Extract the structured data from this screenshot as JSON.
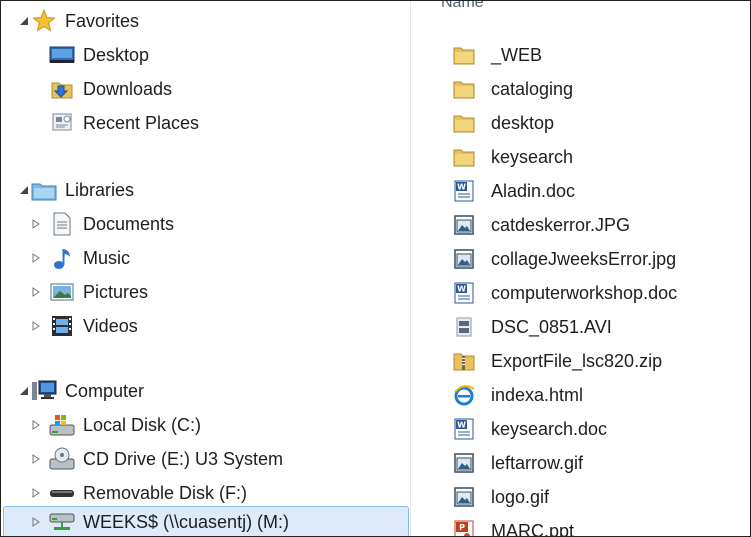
{
  "nav": {
    "favorites": {
      "label": "Favorites",
      "items": [
        {
          "label": "Desktop",
          "icon": "desktop-icon"
        },
        {
          "label": "Downloads",
          "icon": "downloads-icon"
        },
        {
          "label": "Recent Places",
          "icon": "recent-places-icon"
        }
      ]
    },
    "libraries": {
      "label": "Libraries",
      "items": [
        {
          "label": "Documents",
          "icon": "documents-icon"
        },
        {
          "label": "Music",
          "icon": "music-icon"
        },
        {
          "label": "Pictures",
          "icon": "pictures-icon"
        },
        {
          "label": "Videos",
          "icon": "videos-icon"
        }
      ]
    },
    "computer": {
      "label": "Computer",
      "items": [
        {
          "label": "Local Disk (C:)",
          "icon": "local-disk-icon"
        },
        {
          "label": "CD Drive (E:) U3 System",
          "icon": "cd-drive-icon"
        },
        {
          "label": "Removable Disk (F:)",
          "icon": "removable-disk-icon"
        },
        {
          "label": "WEEKS$ (\\\\cuasentj) (M:)",
          "icon": "network-drive-icon",
          "selected": true
        }
      ]
    }
  },
  "files": {
    "column_header": "Name",
    "items": [
      {
        "name": "_WEB",
        "type": "folder"
      },
      {
        "name": "cataloging",
        "type": "folder"
      },
      {
        "name": "desktop",
        "type": "folder"
      },
      {
        "name": "keysearch",
        "type": "folder"
      },
      {
        "name": "Aladin.doc",
        "type": "word"
      },
      {
        "name": "catdeskerror.JPG",
        "type": "image"
      },
      {
        "name": "collageJweeksError.jpg",
        "type": "image"
      },
      {
        "name": "computerworkshop.doc",
        "type": "word"
      },
      {
        "name": "DSC_0851.AVI",
        "type": "video"
      },
      {
        "name": "ExportFile_lsc820.zip",
        "type": "zip"
      },
      {
        "name": "indexa.html",
        "type": "html"
      },
      {
        "name": "keysearch.doc",
        "type": "word"
      },
      {
        "name": "leftarrow.gif",
        "type": "image"
      },
      {
        "name": "logo.gif",
        "type": "image"
      },
      {
        "name": "MARC.ppt",
        "type": "ppt"
      }
    ]
  },
  "colors": {
    "selection_bg": "#dceaf9",
    "selection_border": "#8cbbe9",
    "folder": "#e8c15a",
    "header_text": "#4c607a"
  }
}
